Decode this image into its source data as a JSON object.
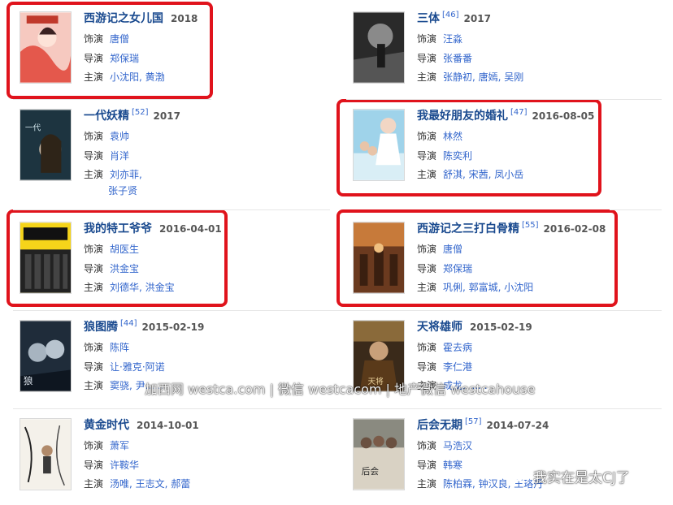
{
  "labels": {
    "role": "饰演",
    "director": "导演",
    "star": "主演"
  },
  "films": [
    {
      "title": "西游记之女儿国",
      "ref": "",
      "year": "2018",
      "role": "唐僧",
      "director": "郑保瑞",
      "star": "小沈阳, 黄渤",
      "star2": "",
      "poster": "poster-icon"
    },
    {
      "title": "三体",
      "ref": "[46]",
      "year": "2017",
      "role": "汪淼",
      "director": "张番番",
      "star": "张静初, 唐嫣, 吴刚",
      "star2": "",
      "poster": "poster-icon"
    },
    {
      "title": "一代妖精",
      "ref": "[52]",
      "year": "2017",
      "role": "袁帅",
      "director": "肖洋",
      "star": "刘亦菲,",
      "star2": "张子贤",
      "poster": "poster-icon"
    },
    {
      "title": "我最好朋友的婚礼",
      "ref": "[47]",
      "year": "2016-08-05",
      "role": "林然",
      "director": "陈奕利",
      "star": "舒淇, 宋茜, 凤小岳",
      "star2": "",
      "poster": "poster-icon"
    },
    {
      "title": "我的特工爷爷",
      "ref": "",
      "year": "2016-04-01",
      "role": "胡医生",
      "director": "洪金宝",
      "star": "刘德华, 洪金宝",
      "star2": "",
      "poster": "poster-icon"
    },
    {
      "title": "西游记之三打白骨精",
      "ref": "[55]",
      "year": "2016-02-08",
      "role": "唐僧",
      "director": "郑保瑞",
      "star": "巩俐, 郭富城, 小沈阳",
      "star2": "",
      "poster": "poster-icon"
    },
    {
      "title": "狼图腾",
      "ref": "[44]",
      "year": "2015-02-19",
      "role": "陈阵",
      "director": "让·雅克·阿诺",
      "star": "窦骁, 尹......",
      "star2": "",
      "poster": "poster-icon"
    },
    {
      "title": "天将雄师",
      "ref": "",
      "year": "2015-02-19",
      "role": "霍去病",
      "director": "李仁港",
      "star": "成龙, ......",
      "star2": "",
      "poster": "poster-icon"
    },
    {
      "title": "黄金时代",
      "ref": "",
      "year": "2014-10-01",
      "role": "萧军",
      "director": "许鞍华",
      "star": "汤唯, 王志文, 郝蕾",
      "star2": "",
      "poster": "poster-icon"
    },
    {
      "title": "后会无期",
      "ref": "[57]",
      "year": "2014-07-24",
      "role": "马浩汉",
      "director": "韩寒",
      "star": "陈柏霖, 钟汉良, 王珞丹",
      "star2": "",
      "poster": "poster-icon"
    }
  ],
  "watermark": "加西网 westca.com | 微信 westcacom | 地产微信 westcahouse",
  "wechat_tag": "我实在是太CJ了",
  "colors": {
    "highlight": "#e0131c",
    "title": "#1a4a8f",
    "link": "#3366cc"
  }
}
